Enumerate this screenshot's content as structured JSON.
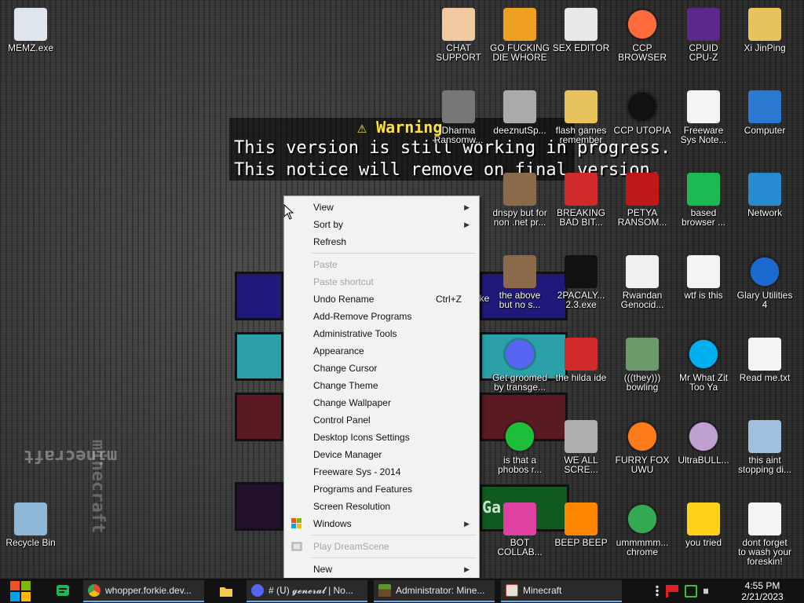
{
  "background": {
    "warning_title": "⚠ Warning",
    "warning_line1": "This version is still working in progress.",
    "warning_line2": "This notice will remove on final version.",
    "vertical_text_left": "minecraft",
    "vertical_text_bottom": "minecraft",
    "gallery_text": "Ga"
  },
  "desktop_icons": [
    {
      "label": "MEMZ.exe",
      "icon": "window-icon"
    },
    {
      "label": "CHAT\nSUPPORT",
      "icon": "support-agent-icon"
    },
    {
      "label": "GO FUCKING\nDIE WHORE",
      "icon": "de-logo-icon"
    },
    {
      "label": "SEX EDITOR",
      "icon": "hxd-icon"
    },
    {
      "label": "CCP\nBROWSER",
      "icon": "pinwheel-icon"
    },
    {
      "label": "CPUID\nCPU-Z",
      "icon": "cpu-z-icon"
    },
    {
      "label": "Xi JinPing",
      "icon": "user-folder-icon"
    },
    {
      "label": "Dharma\nRansomw...",
      "icon": "skull-icon"
    },
    {
      "label": "deeznutSp...",
      "icon": "squares-icon"
    },
    {
      "label": "flash games\nremember",
      "icon": "flash-games-icon"
    },
    {
      "label": "CCP UTOPIA",
      "icon": "ccp-utopia-icon"
    },
    {
      "label": "Freeware\nSys Note...",
      "icon": "document-icon"
    },
    {
      "label": "Computer",
      "icon": "monitor-icon"
    },
    {
      "label": "dnspy but for\nnon .net pr...",
      "icon": "portrait-icon"
    },
    {
      "label": "BREAKING\nBAD BIT...",
      "icon": "angry-bird-icon"
    },
    {
      "label": "PETYA\nRANSOM...",
      "icon": "skull-red-icon"
    },
    {
      "label": "based\nbrowser ...",
      "icon": "green-chat-icon"
    },
    {
      "label": "Network",
      "icon": "network-icon"
    },
    {
      "label": "ke",
      "icon": "none"
    },
    {
      "label": "the above\nbut no s...",
      "icon": "portrait-64-icon"
    },
    {
      "label": "2PACALY...\n2.3.exe",
      "icon": "console-icon"
    },
    {
      "label": "Rwandan\nGenocid...",
      "icon": "meme-face-icon"
    },
    {
      "label": "wtf is this",
      "icon": "calendar-doc-icon"
    },
    {
      "label": "Glary Utilities\n4",
      "icon": "glary-icon"
    },
    {
      "label": "Get groomed\nby transge...",
      "icon": "discord-icon"
    },
    {
      "label": "the hilda ide",
      "icon": "devcpp-icon"
    },
    {
      "label": "(((they)))\nbowling",
      "icon": "bowling-icon"
    },
    {
      "label": "Mr What Zit\nToo Ya",
      "icon": "skype-icon"
    },
    {
      "label": "Read me.txt",
      "icon": "text-file-icon"
    },
    {
      "label": "is that a\nphobos r...",
      "icon": "phobos-icon"
    },
    {
      "label": "WE ALL\nSCRE...",
      "icon": "computer-old-icon"
    },
    {
      "label": "FURRY FOX\nUWU",
      "icon": "firefox-icon"
    },
    {
      "label": "UltraBULL...",
      "icon": "disc-icon"
    },
    {
      "label": "this aint\nstopping di...",
      "icon": "magnifier-pc-icon"
    },
    {
      "label": "BOT\nCOLLAB...",
      "icon": "pink-monitor-icon"
    },
    {
      "label": "BEEP BEEP",
      "icon": "vlc-icon"
    },
    {
      "label": "ummmmm...\nchrome",
      "icon": "chrome-icon"
    },
    {
      "label": "you tried",
      "icon": "star-icon"
    },
    {
      "label": "dont forget\nto wash your\nforeskin!",
      "icon": "calendar-doc-icon"
    },
    {
      "label": "Recycle Bin",
      "icon": "recycle-bin-icon"
    }
  ],
  "context_menu": {
    "view": "View",
    "sort_by": "Sort by",
    "refresh": "Refresh",
    "paste": "Paste",
    "paste_shortcut": "Paste shortcut",
    "undo_rename": "Undo Rename",
    "undo_shortcut": "Ctrl+Z",
    "add_remove": "Add-Remove Programs",
    "admin_tools": "Administrative Tools",
    "appearance": "Appearance",
    "change_cursor": "Change Cursor",
    "change_theme": "Change Theme",
    "change_wallpaper": "Change Wallpaper",
    "control_panel": "Control Panel",
    "desktop_icons_settings": "Desktop Icons Settings",
    "device_manager": "Device Manager",
    "freeware_sys": "Freeware Sys - 2014",
    "programs_features": "Programs and Features",
    "screen_resolution": "Screen Resolution",
    "windows": "Windows",
    "play_dreamscene": "Play DreamScene",
    "new": "New"
  },
  "taskbar": {
    "task_chrome": "whopper.forkie.dev...",
    "task_discord": "# (ᑌ) 𝓰𝓮𝓷𝓮𝓻𝓪𝓵 | No...",
    "task_admin": "Administrator: Mine...",
    "task_minecraft": "Minecraft",
    "clock_time": "4:55 PM",
    "clock_date": "2/21/2023"
  },
  "colors": {
    "menu_bg": "#f2f2f2",
    "taskbar_bg": "#121212",
    "warning_yellow": "#ffe23a"
  }
}
